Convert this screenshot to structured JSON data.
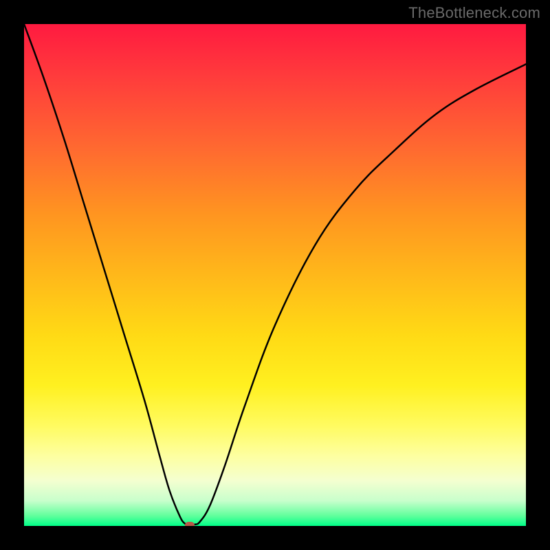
{
  "watermark": "TheBottleneck.com",
  "chart_data": {
    "type": "line",
    "title": "",
    "xlabel": "",
    "ylabel": "",
    "xlim": [
      0,
      100
    ],
    "ylim": [
      0,
      100
    ],
    "grid": false,
    "legend": false,
    "series": [
      {
        "name": "bottleneck-curve",
        "x": [
          0,
          4,
          8,
          12,
          16,
          20,
          24,
          27,
          29,
          31,
          32,
          33,
          34,
          35,
          37,
          40,
          44,
          50,
          58,
          66,
          74,
          82,
          90,
          100
        ],
        "values": [
          100,
          89,
          77,
          64,
          51,
          38,
          25,
          14,
          7,
          2,
          0.5,
          0.2,
          0.3,
          0.8,
          4,
          12,
          24,
          40,
          56,
          67,
          75,
          82,
          87,
          92
        ]
      }
    ],
    "annotations": [
      {
        "name": "min-marker",
        "x": 33,
        "y": 0.2,
        "color": "#b85a4a"
      }
    ],
    "gradient_stops": [
      {
        "pos": 0,
        "color": "#ff1a40"
      },
      {
        "pos": 25,
        "color": "#ff6a30"
      },
      {
        "pos": 50,
        "color": "#ffb81a"
      },
      {
        "pos": 75,
        "color": "#fff020"
      },
      {
        "pos": 100,
        "color": "#00ff88"
      }
    ]
  }
}
